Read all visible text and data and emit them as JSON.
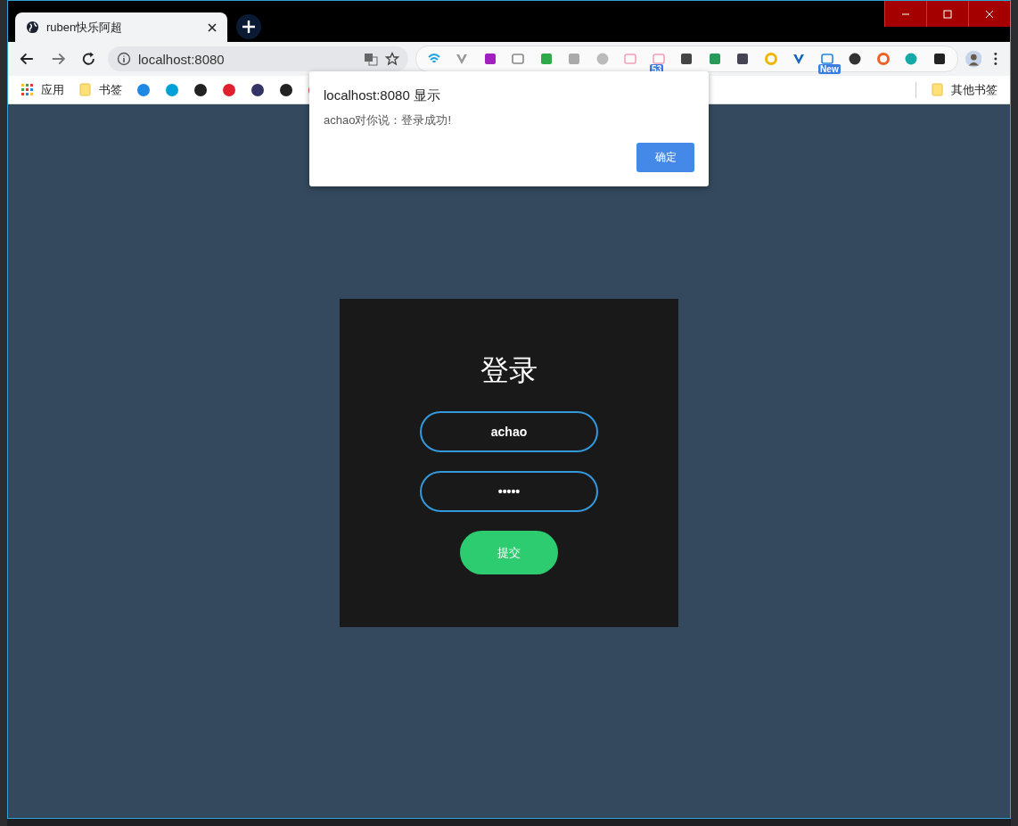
{
  "tab": {
    "title": "ruben快乐阿超",
    "selected": true
  },
  "address_bar": {
    "url": "localhost:8080"
  },
  "extension_badges": [
    "53",
    "New"
  ],
  "bookmarks": {
    "apps": "应用",
    "folder": "书签",
    "other": "其他书签"
  },
  "dialog": {
    "title": "localhost:8080 显示",
    "message": "achao对你说：登录成功!",
    "button": "确定"
  },
  "login": {
    "title": "登录",
    "username": "achao",
    "password": "•••••",
    "submit": "提交"
  }
}
